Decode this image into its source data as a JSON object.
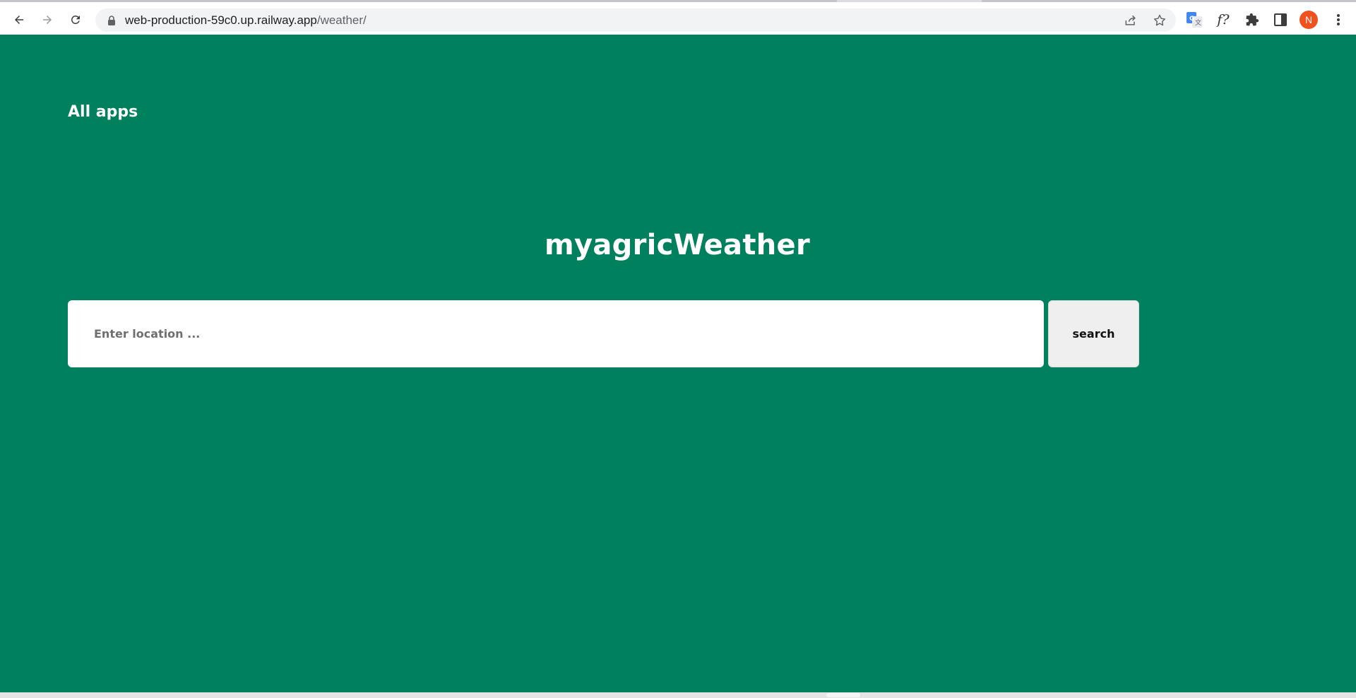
{
  "browser": {
    "url_host": "web-production-59c0.up.railway.app",
    "url_path": "/weather/",
    "avatar_initial": "N",
    "extension_function_label": "f?",
    "icons": {
      "back": "arrow-left-icon",
      "forward": "arrow-right-icon",
      "reload": "reload-icon",
      "lock": "lock-icon",
      "share": "share-icon",
      "bookmark": "star-icon",
      "translate": "google-translate-icon",
      "function": "function-icon",
      "extensions": "puzzle-icon",
      "sidepanel": "side-panel-icon",
      "menu": "kebab-menu-icon"
    },
    "avatar_color": "#f0511e"
  },
  "page": {
    "background_color": "#00805c",
    "nav_link": "All apps",
    "title": "myagricWeather",
    "search": {
      "placeholder": "Enter location ...",
      "value": "",
      "button_label": "search"
    }
  }
}
